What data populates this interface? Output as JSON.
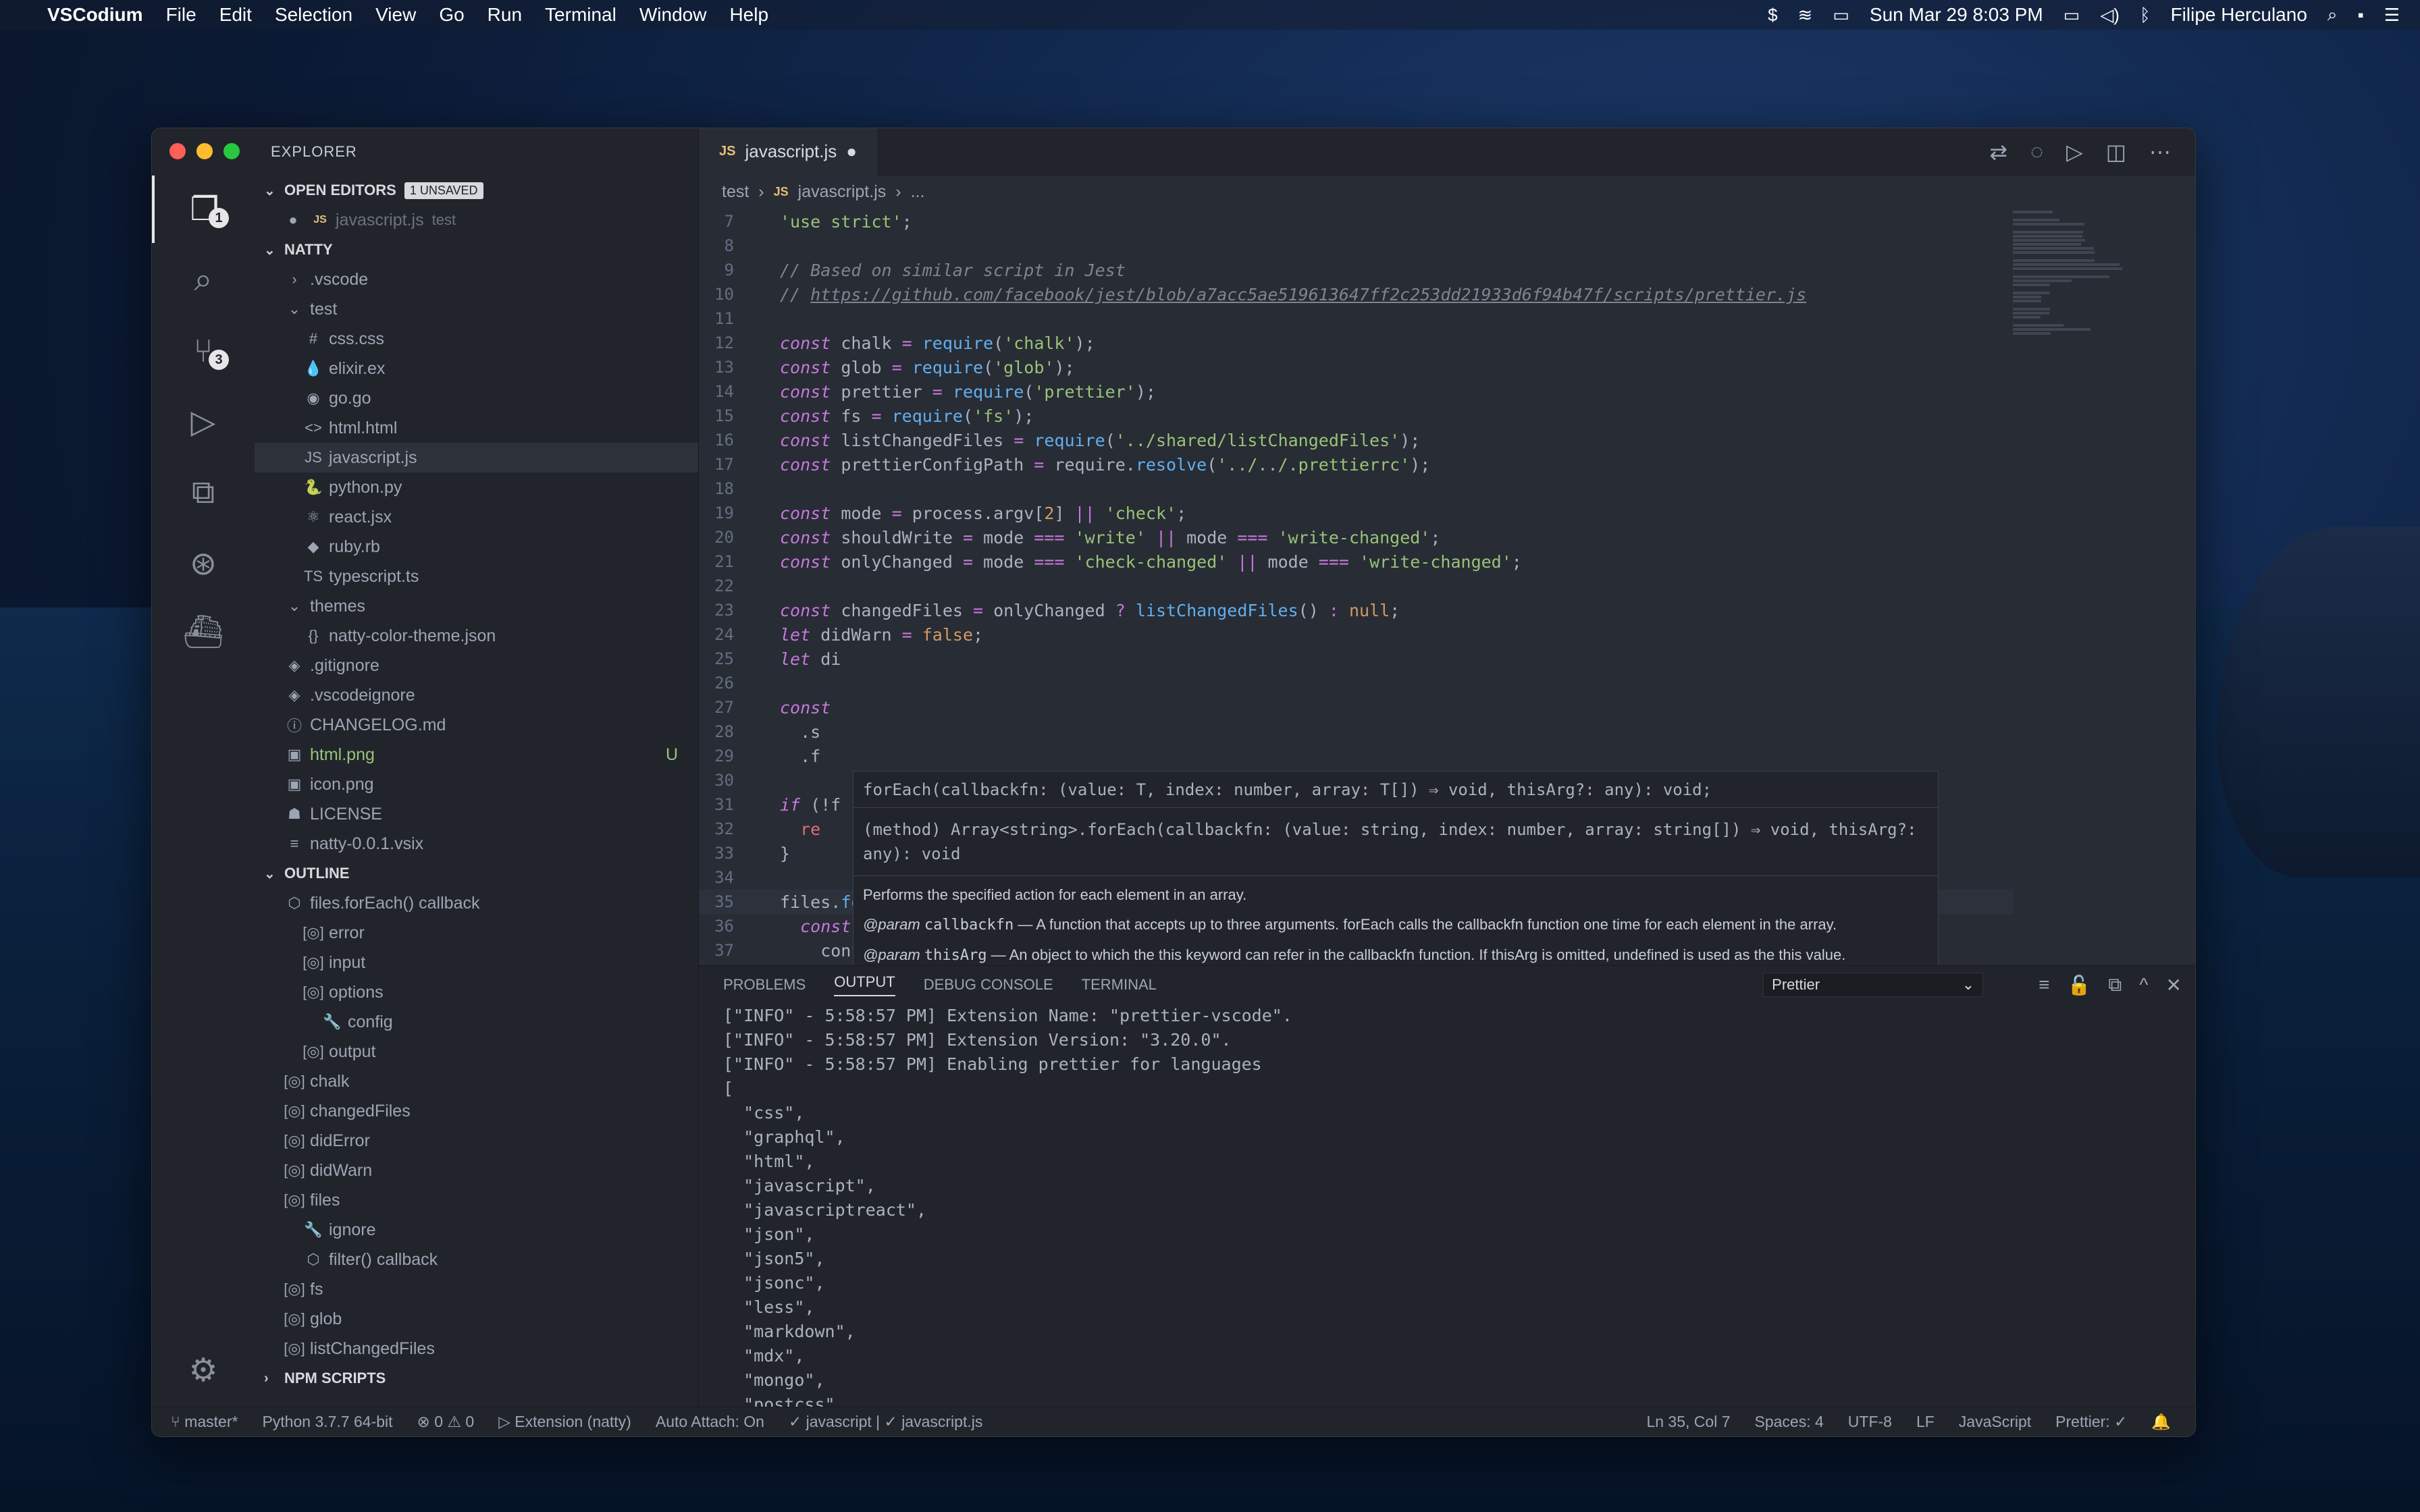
{
  "menubar": {
    "app": "VSCodium",
    "items": [
      "File",
      "Edit",
      "Selection",
      "View",
      "Go",
      "Run",
      "Terminal",
      "Window",
      "Help"
    ],
    "datetime": "Sun Mar 29  8:03 PM",
    "user": "Filipe Herculano"
  },
  "sidebar": {
    "title": "EXPLORER",
    "open_editors": {
      "label": "OPEN EDITORS",
      "badge": "1 UNSAVED",
      "file": "javascript.js",
      "folder": "test"
    },
    "project": "NATTY",
    "files": [
      {
        "name": ".vscode",
        "icon": "›",
        "indent": 1
      },
      {
        "name": "test",
        "icon": "⌄",
        "indent": 1
      },
      {
        "name": "css.css",
        "icon": "#",
        "indent": 2
      },
      {
        "name": "elixir.ex",
        "icon": "💧",
        "indent": 2
      },
      {
        "name": "go.go",
        "icon": "◉",
        "indent": 2
      },
      {
        "name": "html.html",
        "icon": "<>",
        "indent": 2
      },
      {
        "name": "javascript.js",
        "icon": "JS",
        "indent": 2,
        "selected": true
      },
      {
        "name": "python.py",
        "icon": "🐍",
        "indent": 2
      },
      {
        "name": "react.jsx",
        "icon": "⚛",
        "indent": 2
      },
      {
        "name": "ruby.rb",
        "icon": "◆",
        "indent": 2
      },
      {
        "name": "typescript.ts",
        "icon": "TS",
        "indent": 2
      },
      {
        "name": "themes",
        "icon": "⌄",
        "indent": 1
      },
      {
        "name": "natty-color-theme.json",
        "icon": "{}",
        "indent": 2
      },
      {
        "name": ".gitignore",
        "icon": "◈",
        "indent": 1
      },
      {
        "name": ".vscodeignore",
        "icon": "◈",
        "indent": 1
      },
      {
        "name": "CHANGELOG.md",
        "icon": "ⓘ",
        "indent": 1
      },
      {
        "name": "html.png",
        "icon": "▣",
        "indent": 1,
        "git": "U"
      },
      {
        "name": "icon.png",
        "icon": "▣",
        "indent": 1
      },
      {
        "name": "LICENSE",
        "icon": "☗",
        "indent": 1
      },
      {
        "name": "natty-0.0.1.vsix",
        "icon": "≡",
        "indent": 1
      }
    ],
    "outline_label": "OUTLINE",
    "outline": [
      {
        "name": "files.forEach() callback",
        "icon": "⬡",
        "indent": 1
      },
      {
        "name": "error",
        "icon": "[◎]",
        "indent": 2
      },
      {
        "name": "input",
        "icon": "[◎]",
        "indent": 2
      },
      {
        "name": "options",
        "icon": "[◎]",
        "indent": 2
      },
      {
        "name": "config",
        "icon": "🔧",
        "indent": 3
      },
      {
        "name": "output",
        "icon": "[◎]",
        "indent": 2
      },
      {
        "name": "chalk",
        "icon": "[◎]",
        "indent": 1
      },
      {
        "name": "changedFiles",
        "icon": "[◎]",
        "indent": 1
      },
      {
        "name": "didError",
        "icon": "[◎]",
        "indent": 1
      },
      {
        "name": "didWarn",
        "icon": "[◎]",
        "indent": 1
      },
      {
        "name": "files",
        "icon": "[◎]",
        "indent": 1
      },
      {
        "name": "ignore",
        "icon": "🔧",
        "indent": 2
      },
      {
        "name": "filter() callback",
        "icon": "⬡",
        "indent": 2
      },
      {
        "name": "fs",
        "icon": "[◎]",
        "indent": 1
      },
      {
        "name": "glob",
        "icon": "[◎]",
        "indent": 1
      },
      {
        "name": "listChangedFiles",
        "icon": "[◎]",
        "indent": 1
      }
    ],
    "npm_label": "NPM SCRIPTS"
  },
  "editor": {
    "tab": "javascript.js",
    "breadcrumb": [
      "test",
      "javascript.js",
      "..."
    ],
    "lines": [
      {
        "n": "7",
        "html": "<span class='str'>'use strict'</span>;"
      },
      {
        "n": "8",
        "html": ""
      },
      {
        "n": "9",
        "html": "<span class='cm'>// Based on similar script in Jest</span>"
      },
      {
        "n": "10",
        "html": "<span class='cm'>// <u>https://github.com/facebook/jest/blob/a7acc5ae519613647ff2c253dd21933d6f94b47f/scripts/prettier.js</u></span>"
      },
      {
        "n": "11",
        "html": ""
      },
      {
        "n": "12",
        "html": "<span class='kw'>const</span> chalk <span class='op'>=</span> <span class='fn'>require</span>(<span class='str'>'chalk'</span>);"
      },
      {
        "n": "13",
        "html": "<span class='kw'>const</span> glob <span class='op'>=</span> <span class='fn'>require</span>(<span class='str'>'glob'</span>);"
      },
      {
        "n": "14",
        "html": "<span class='kw'>const</span> prettier <span class='op'>=</span> <span class='fn'>require</span>(<span class='str'>'prettier'</span>);"
      },
      {
        "n": "15",
        "html": "<span class='kw'>const</span> fs <span class='op'>=</span> <span class='fn'>require</span>(<span class='str'>'fs'</span>);"
      },
      {
        "n": "16",
        "html": "<span class='kw'>const</span> listChangedFiles <span class='op'>=</span> <span class='fn'>require</span>(<span class='str'>'../shared/listChangedFiles'</span>);"
      },
      {
        "n": "17",
        "html": "<span class='kw'>const</span> prettierConfigPath <span class='op'>=</span> require.<span class='fn'>resolve</span>(<span class='str'>'../../.prettierrc'</span>);"
      },
      {
        "n": "18",
        "html": ""
      },
      {
        "n": "19",
        "html": "<span class='kw'>const</span> mode <span class='op'>=</span> process.argv[<span class='num'>2</span>] <span class='op'>||</span> <span class='str'>'check'</span>;"
      },
      {
        "n": "20",
        "html": "<span class='kw'>const</span> shouldWrite <span class='op'>=</span> mode <span class='op'>===</span> <span class='str'>'write'</span> <span class='op'>||</span> mode <span class='op'>===</span> <span class='str'>'write-changed'</span>;"
      },
      {
        "n": "21",
        "html": "<span class='kw'>const</span> onlyChanged <span class='op'>=</span> mode <span class='op'>===</span> <span class='str'>'check-changed'</span> <span class='op'>||</span> mode <span class='op'>===</span> <span class='str'>'write-changed'</span>;"
      },
      {
        "n": "22",
        "html": ""
      },
      {
        "n": "23",
        "html": "<span class='kw'>const</span> changedFiles <span class='op'>=</span> onlyChanged <span class='op'>?</span> <span class='fn'>listChangedFiles</span>() <span class='op'>:</span> <span class='num'>null</span>;"
      },
      {
        "n": "24",
        "html": "<span class='kw'>let</span> didWarn <span class='op'>=</span> <span class='num'>false</span>;"
      },
      {
        "n": "25",
        "html": "<span class='kw'>let</span> di"
      },
      {
        "n": "26",
        "html": ""
      },
      {
        "n": "27",
        "html": "<span class='kw'>const</span>"
      },
      {
        "n": "28",
        "html": "  .s"
      },
      {
        "n": "29",
        "html": "  .f"
      },
      {
        "n": "30",
        "html": ""
      },
      {
        "n": "31",
        "html": "<span class='kw'>if</span> (!f"
      },
      {
        "n": "32",
        "html": "  <span class='pl'>re</span>"
      },
      {
        "n": "33",
        "html": "}"
      },
      {
        "n": "34",
        "html": ""
      },
      {
        "n": "35",
        "html": "files.<span class='fn'>forEach</span>(file <span class='op'>⇒</span> {",
        "current": true
      },
      {
        "n": "36",
        "html": "  <span class='kw'>const</span> options <span class='op'>=</span> prettier.<span class='fn'>resolveConfig</span>.<span class='fn'>sync</span>(file, {"
      },
      {
        "n": "37",
        "html": "    config: prettierConfigPath,"
      }
    ],
    "hover": {
      "signature": "forEach(callbackfn: (value: T, index: number, array: T[]) ⇒ void, thisArg?: any): void;",
      "declaration": "(method) Array<string>.forEach(callbackfn: (value: string, index: number, array: string[]) ⇒ void, thisArg?: any): void",
      "summary": "Performs the specified action for each element in an array.",
      "param1_tag": "@param",
      "param1_name": "callbackfn",
      "param1_text": "— A function that accepts up to three arguments. forEach calls the callbackfn function one time for each element in the array.",
      "param2_tag": "@param",
      "param2_name": "thisArg",
      "param2_text": "— An object to which the this keyword can refer in the callbackfn function. If thisArg is omitted, undefined is used as the this value."
    }
  },
  "panel": {
    "tabs": [
      "PROBLEMS",
      "OUTPUT",
      "DEBUG CONSOLE",
      "TERMINAL"
    ],
    "active_tab": "OUTPUT",
    "channel": "Prettier",
    "output": [
      "[\"INFO\" - 5:58:57 PM] Extension Name: \"prettier-vscode\".",
      "[\"INFO\" - 5:58:57 PM] Extension Version: \"3.20.0\".",
      "[\"INFO\" - 5:58:57 PM] Enabling prettier for languages",
      "[",
      "  \"css\",",
      "  \"graphql\",",
      "  \"html\",",
      "  \"javascript\",",
      "  \"javascriptreact\",",
      "  \"json\",",
      "  \"json5\",",
      "  \"jsonc\",",
      "  \"less\",",
      "  \"markdown\",",
      "  \"mdx\",",
      "  \"mongo\",",
      "  \"postcss\","
    ]
  },
  "statusbar": {
    "branch": "master*",
    "python": "Python 3.7.7 64-bit",
    "problems": "⊗ 0 ⚠ 0",
    "extension": "Extension (natty)",
    "attach": "Auto Attach: On",
    "linter": "✓ javascript | ✓ javascript.js",
    "position": "Ln 35, Col 7",
    "spaces": "Spaces: 4",
    "encoding": "UTF-8",
    "eol": "LF",
    "language": "JavaScript",
    "prettier": "Prettier: ✓"
  },
  "badges": {
    "explorer": "1",
    "scm": "3"
  }
}
